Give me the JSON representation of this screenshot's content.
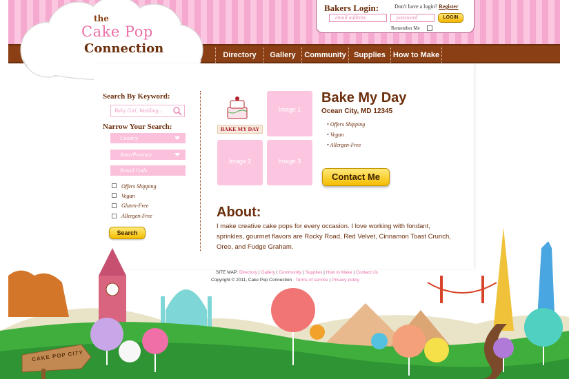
{
  "brand": {
    "line1": "the",
    "line2": "Cake Pop",
    "line3": "Connection"
  },
  "login": {
    "title": "Bakers Login:",
    "no_account": "Don't have a login?",
    "register": "Register",
    "email_placeholder": "email address",
    "password_placeholder": "password",
    "button": "LOGIN",
    "remember": "Remember Me"
  },
  "nav": [
    "Directory",
    "Gallery",
    "Community",
    "Supplies",
    "How to Make"
  ],
  "sidebar": {
    "keyword_heading": "Search By Keyword:",
    "keyword_placeholder": "Baby Girl, Wedding...",
    "narrow_heading": "Narrow Your Search:",
    "country": "Country",
    "state": "State/Province",
    "postal": "Postal Code",
    "filters": [
      "Offers Shipping",
      "Vegan",
      "Gluten-Free",
      "Allergen-Free"
    ],
    "search_button": "Search"
  },
  "profile": {
    "logo_text": "BAKE MY DAY",
    "image1": "Image 1",
    "image2": "Image 2",
    "image3": "Image 3",
    "name": "Bake My Day",
    "location": "Ocean City, MD 12345",
    "features": [
      "Offers Shipping",
      "Vegan",
      "Allergen-Free"
    ],
    "contact_button": "Contact Me",
    "about_heading": "About:",
    "about_text": "I make creative cake pops for every occasion. I love working with fondant, sprinkles, gourmet flavors are Rocky Road, Red Velvet, Cinnamon Toast Crunch, Oreo, and Fudge Graham."
  },
  "footer": {
    "sitemap_label": "SITE MAP:",
    "sitemap_links": [
      "Directory",
      "Gallery",
      "Community",
      "Supplies",
      "How to Make",
      "Contact Us"
    ],
    "copyright": "Copyright © 2011, Cake Pop Connection",
    "legal_links": [
      "Terms of service",
      "Privacy policy"
    ]
  },
  "scene": {
    "sign_text": "CAKE POP CITY"
  },
  "colors": {
    "brown": "#6b2e0c",
    "pink": "#f6a9cf",
    "tile_pink": "#fcc6e1",
    "button_yellow": "#f5bd00",
    "grass": "#3fae3c"
  }
}
